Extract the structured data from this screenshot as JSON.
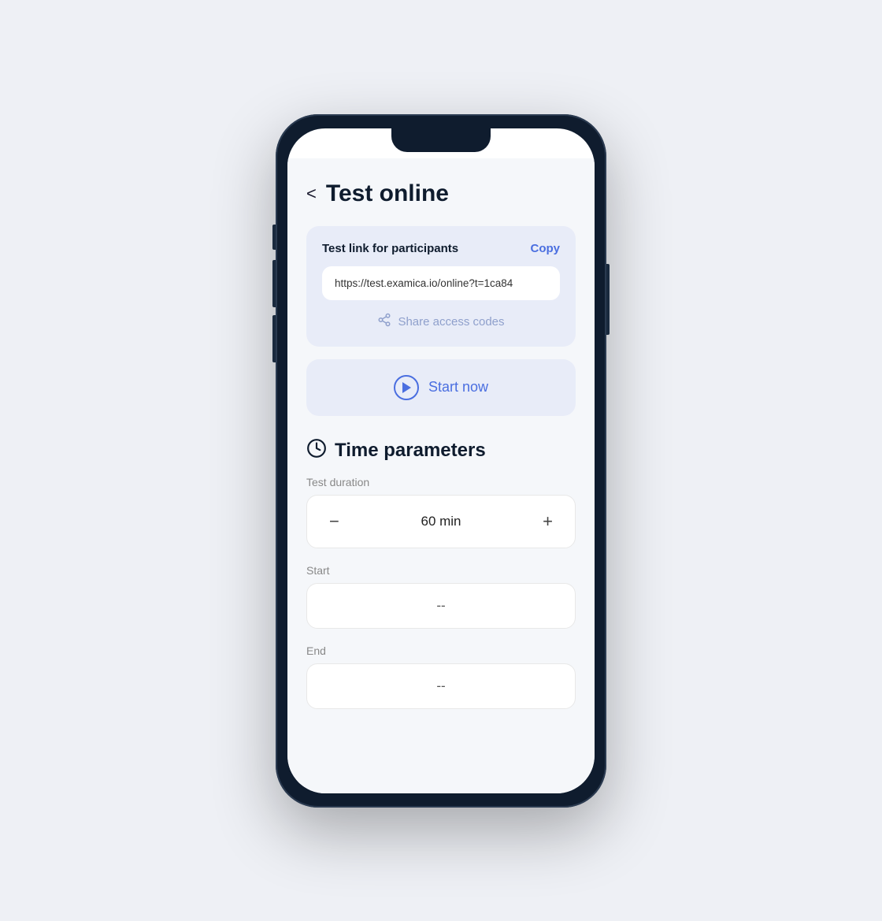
{
  "page": {
    "title": "Test online",
    "back_label": "<"
  },
  "link_card": {
    "title": "Test link for participants",
    "copy_label": "Copy",
    "link_value": "https://test.examica.io/online?t=1ca84",
    "share_codes_label": "Share access codes"
  },
  "start_button": {
    "label": "Start now"
  },
  "time_section": {
    "title": "Time parameters",
    "duration_label": "Test duration",
    "duration_value": "60 min",
    "start_label": "Start",
    "start_value": "--",
    "end_label": "End",
    "end_value": "--",
    "decrement_label": "−",
    "increment_label": "+"
  }
}
